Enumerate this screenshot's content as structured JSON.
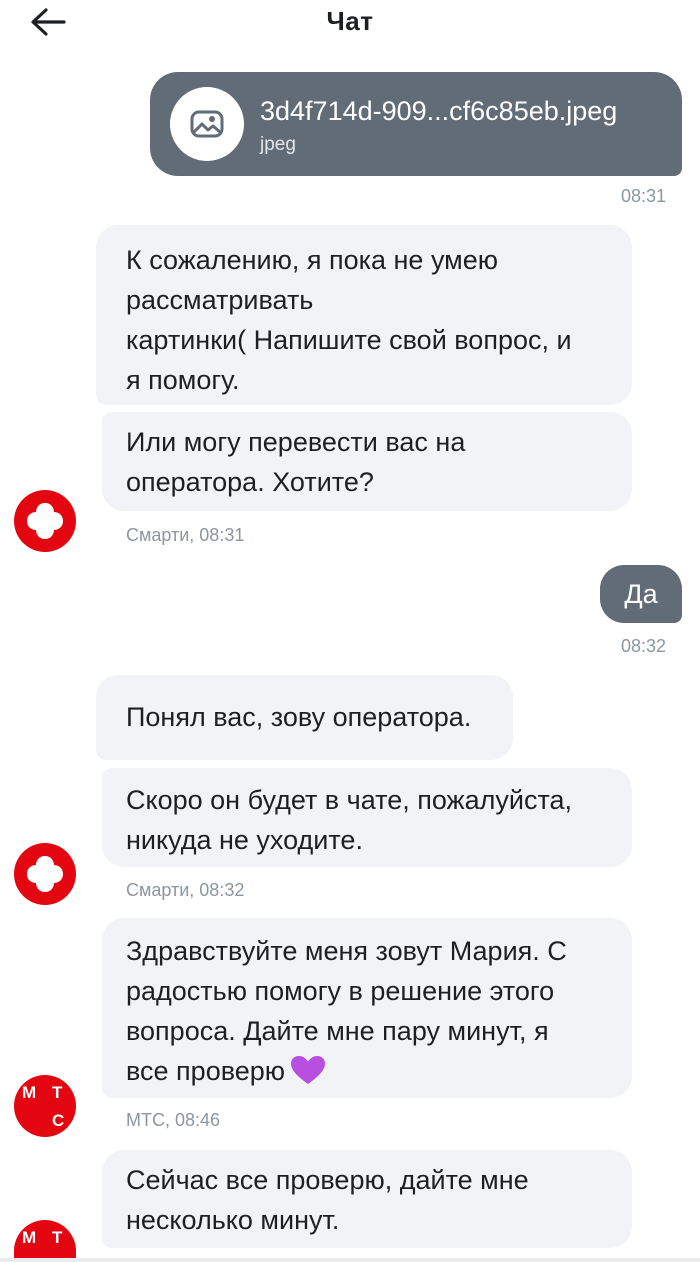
{
  "header": {
    "title": "Чат",
    "back_icon": "arrow-left-icon"
  },
  "file_message": {
    "file_name": "3d4f714d-909...cf6c85eb.jpeg",
    "file_type": "jpeg",
    "icon": "image-icon",
    "time": "08:31"
  },
  "messages_group1": {
    "msg1": "К сожалению, я пока не умею\nрассматривать\nкартинки( Напишите свой вопрос, и\nя помогу.",
    "msg2": "Или могу перевести вас на\nоператора. Хотите?",
    "sender_time": "Смарти, 08:31",
    "avatar_icon": "smarty-logo-icon"
  },
  "user_reply": {
    "text": "Да",
    "time": "08:32"
  },
  "messages_group2": {
    "msg1": "Понял вас, зову оператора.",
    "msg2": "Скоро он будет в чате, пожалуйста,\nникуда не уходите.",
    "sender_time": "Смарти, 08:32",
    "avatar_icon": "smarty-logo-icon"
  },
  "messages_group3": {
    "msg1": "Здравствуйте меня зовут Мария. С\nрадостью помогу в решение этого\nвопроса. Дайте мне пару минут, я\nвсе проверю",
    "msg1_emoji": "purple-heart-icon",
    "sender_time": "МТС, 08:46",
    "avatar_letters": [
      "М",
      "Т",
      "С"
    ]
  },
  "messages_group4": {
    "msg1": "Сейчас все проверю, дайте мне\nнесколько минут.",
    "avatar_letters": [
      "М",
      "Т"
    ]
  },
  "colors": {
    "brand_red": "#e30611",
    "outgoing_bubble": "#626c77",
    "incoming_bubble": "#f2f3f7",
    "purple_heart": "#b84fe0"
  }
}
